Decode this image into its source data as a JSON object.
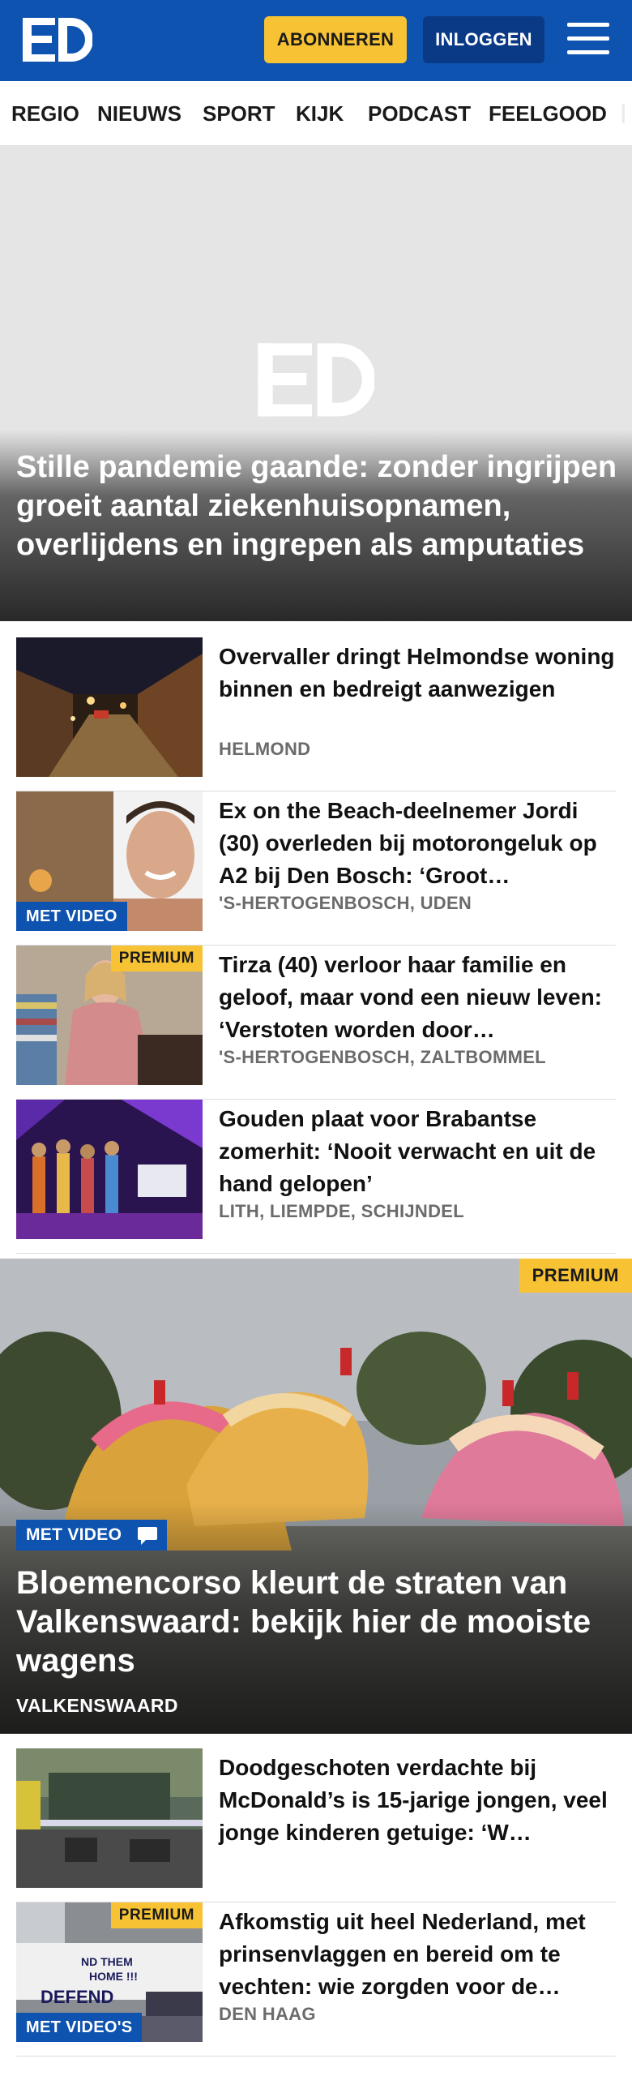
{
  "header": {
    "logo_text": "ED",
    "subscribe_label": "ABONNEREN",
    "login_label": "INLOGGEN",
    "menu_icon": "hamburger-menu-icon",
    "background_color": "#0e53b0",
    "subscribe_color": "#f7c234"
  },
  "nav": {
    "items": [
      "REGIO",
      "NIEUWS",
      "SPORT",
      "KIJK",
      "PODCAST",
      "FEELGOOD"
    ]
  },
  "hero": {
    "title": "Stille pandemie gaande: zonder ingrijpen groeit aantal ziekenhuisop­namen, overlijdens en ingrepen als amputaties"
  },
  "articles": [
    {
      "title": "Overvaller dringt Helmondse woning binnen en bedreigt aanwezigen",
      "location": "HELMOND"
    },
    {
      "title": "Ex on the Beach-deelnemer Jordi (30) overleden bij motorongeluk op A2 bij Den Bosch: ‘Groot…",
      "location": "'S-HERTOGENBOSCH, UDEN",
      "badge": "MET VIDEO"
    },
    {
      "title": "Tirza (40) verloor haar familie en geloof, maar vond een nieuw leven: ‘Verstoten worden door…",
      "location": "'S-HERTOGENBOSCH, ZALTBOMMEL",
      "premium": "PREMIUM"
    },
    {
      "title": "Gouden plaat voor Brabantse zomerhit: ‘Nooit verwacht en uit de hand gelopen’",
      "location": "LITH, LIEMPDE, SCHIJNDEL"
    }
  ],
  "feature": {
    "premium": "PREMIUM",
    "badge": "MET VIDEO",
    "comment_icon": "comment-icon",
    "title": "Bloemencorso kleurt de straten van Valkenswaard: bekijk hier de mooiste wagens",
    "location": "VALKENSWAARD"
  },
  "articles2": [
    {
      "title": "Doodgeschoten verdachte bij McDonald’s is 15-jarige jongen, veel jonge kinderen getuige: ‘W…",
      "location": ""
    },
    {
      "title": "Afkomstig uit heel Nederland, met prinsenvlaggen en bereid om te vechten: wie zorgden voor de…",
      "location": "DEN HAAG",
      "premium": "PREMIUM",
      "badge": "MET VIDEO'S",
      "image_text": "ND THEM HOME !!! DEFEND"
    }
  ]
}
